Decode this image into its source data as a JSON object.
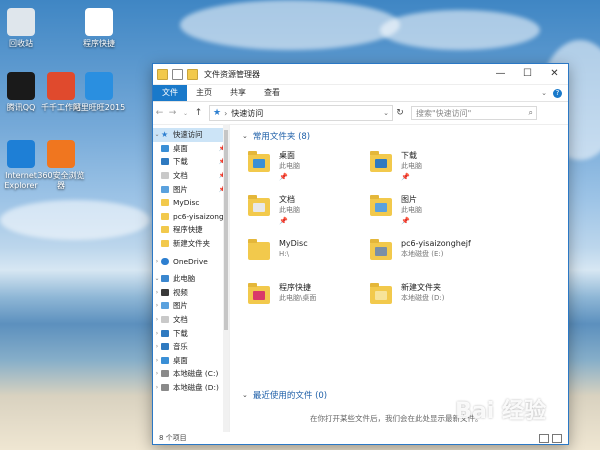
{
  "desktop": {
    "icons": [
      {
        "label": "回收站",
        "color": "#dfe6ec"
      },
      {
        "label": "程序快捷",
        "color": "#ffffff"
      },
      {
        "label": "腾讯QQ",
        "color": "#1a1a1a"
      },
      {
        "label": "千千工作站",
        "color": "#e04a2d"
      },
      {
        "label": "阿里旺旺2015",
        "color": "#2a8fe0"
      },
      {
        "label": "Internet Explorer",
        "color": "#1e7fd6"
      },
      {
        "label": "360安全浏览器",
        "color": "#f0761f"
      }
    ]
  },
  "window": {
    "title": "文件资源管理器",
    "controls": {
      "minimize": "—",
      "maximize": "☐",
      "close": "✕"
    },
    "ribbon_tabs": [
      "文件",
      "主页",
      "共享",
      "查看"
    ],
    "address": {
      "path": "快速访问",
      "separator": "›"
    },
    "search_placeholder": "搜索\"快速访问\"",
    "nav": {
      "quick_access": "快速访问",
      "items": [
        {
          "label": "桌面",
          "pinned": true,
          "color": "#3a8fd6"
        },
        {
          "label": "下载",
          "pinned": true,
          "color": "#2f7ac0"
        },
        {
          "label": "文档",
          "pinned": true,
          "color": "#c9c9c9"
        },
        {
          "label": "图片",
          "pinned": true,
          "color": "#5aa1de"
        },
        {
          "label": "MyDisc",
          "pinned": false,
          "color": "#f2c94c"
        },
        {
          "label": "pc6-yisaizonghejf",
          "pinned": false,
          "color": "#f2c94c"
        },
        {
          "label": "程序快捷",
          "pinned": false,
          "color": "#f2c94c"
        },
        {
          "label": "新建文件夹",
          "pinned": false,
          "color": "#f2c94c"
        }
      ],
      "onedrive": "OneDrive",
      "this_pc": "此电脑",
      "pc_items": [
        {
          "label": "视频",
          "color": "#3a3a3a"
        },
        {
          "label": "图片",
          "color": "#5aa1de"
        },
        {
          "label": "文档",
          "color": "#c9c9c9"
        },
        {
          "label": "下载",
          "color": "#2f7ac0"
        },
        {
          "label": "音乐",
          "color": "#2f7ac0"
        },
        {
          "label": "桌面",
          "color": "#3a8fd6"
        },
        {
          "label": "本地磁盘 (C:)",
          "color": "#8a8a8a"
        },
        {
          "label": "本地磁盘 (D:)",
          "color": "#8a8a8a"
        }
      ]
    },
    "frequent": {
      "header": "常用文件夹 (8)",
      "folders": [
        {
          "name": "桌面",
          "sub": "此电脑",
          "pinned": true,
          "badge": "#3a8fd6"
        },
        {
          "name": "下载",
          "sub": "此电脑",
          "pinned": true,
          "badge": "#2f7ac0"
        },
        {
          "name": "文档",
          "sub": "此电脑",
          "pinned": true,
          "badge": "#e8e8e8"
        },
        {
          "name": "图片",
          "sub": "此电脑",
          "pinned": true,
          "badge": "#5aa1de"
        },
        {
          "name": "MyDisc",
          "sub": "H:\\",
          "pinned": false,
          "badge": "#f2c94c"
        },
        {
          "name": "pc6-yisaizonghejf",
          "sub": "本地磁盘 (E:)",
          "pinned": false,
          "badge": "#7a8fa6"
        },
        {
          "name": "程序快捷",
          "sub": "此电脑\\桌面",
          "pinned": false,
          "badge": "#d93a6a"
        },
        {
          "name": "新建文件夹",
          "sub": "本地磁盘 (D:)",
          "pinned": false,
          "badge": "#f7e39a"
        }
      ]
    },
    "recent": {
      "header": "最近使用的文件 (0)",
      "empty_text": "在你打开某些文件后，我们会在此处显示最新文件。"
    },
    "status": "8 个项目"
  },
  "watermark": {
    "text": "Bai 经验",
    "sub": "jingyan.baidu.com"
  }
}
